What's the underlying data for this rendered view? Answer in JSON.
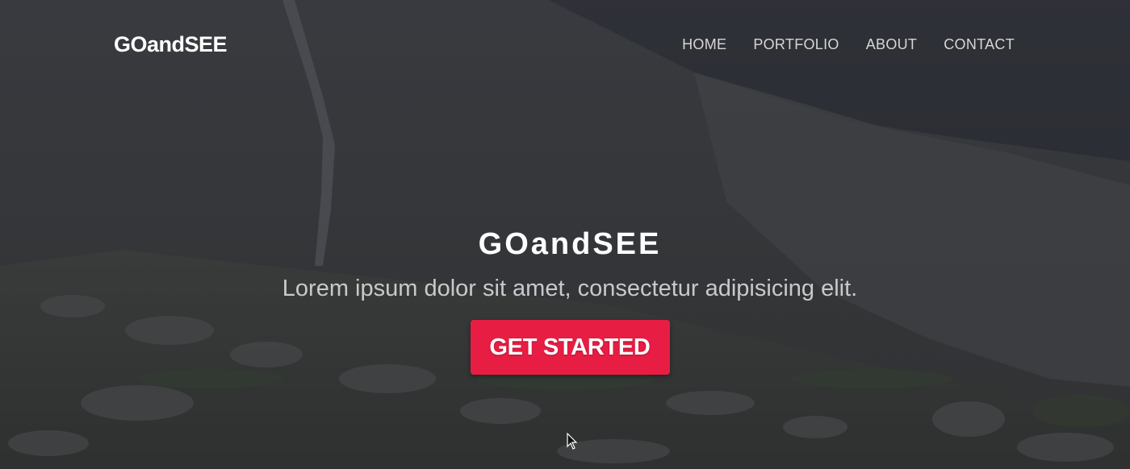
{
  "brand": {
    "name": "GOandSEE"
  },
  "nav": {
    "items": [
      {
        "label": "HOME"
      },
      {
        "label": "PORTFOLIO"
      },
      {
        "label": "ABOUT"
      },
      {
        "label": "CONTACT"
      }
    ]
  },
  "hero": {
    "title": "GOandSEE",
    "subtitle": "Lorem ipsum dolor sit amet, consectetur adipisicing elit.",
    "cta_label": "GET STARTED",
    "background_icon": "mountain-landscape"
  },
  "colors": {
    "accent": "#e81d43",
    "text": "#ffffff",
    "nav_text": "#d6d6d6"
  }
}
